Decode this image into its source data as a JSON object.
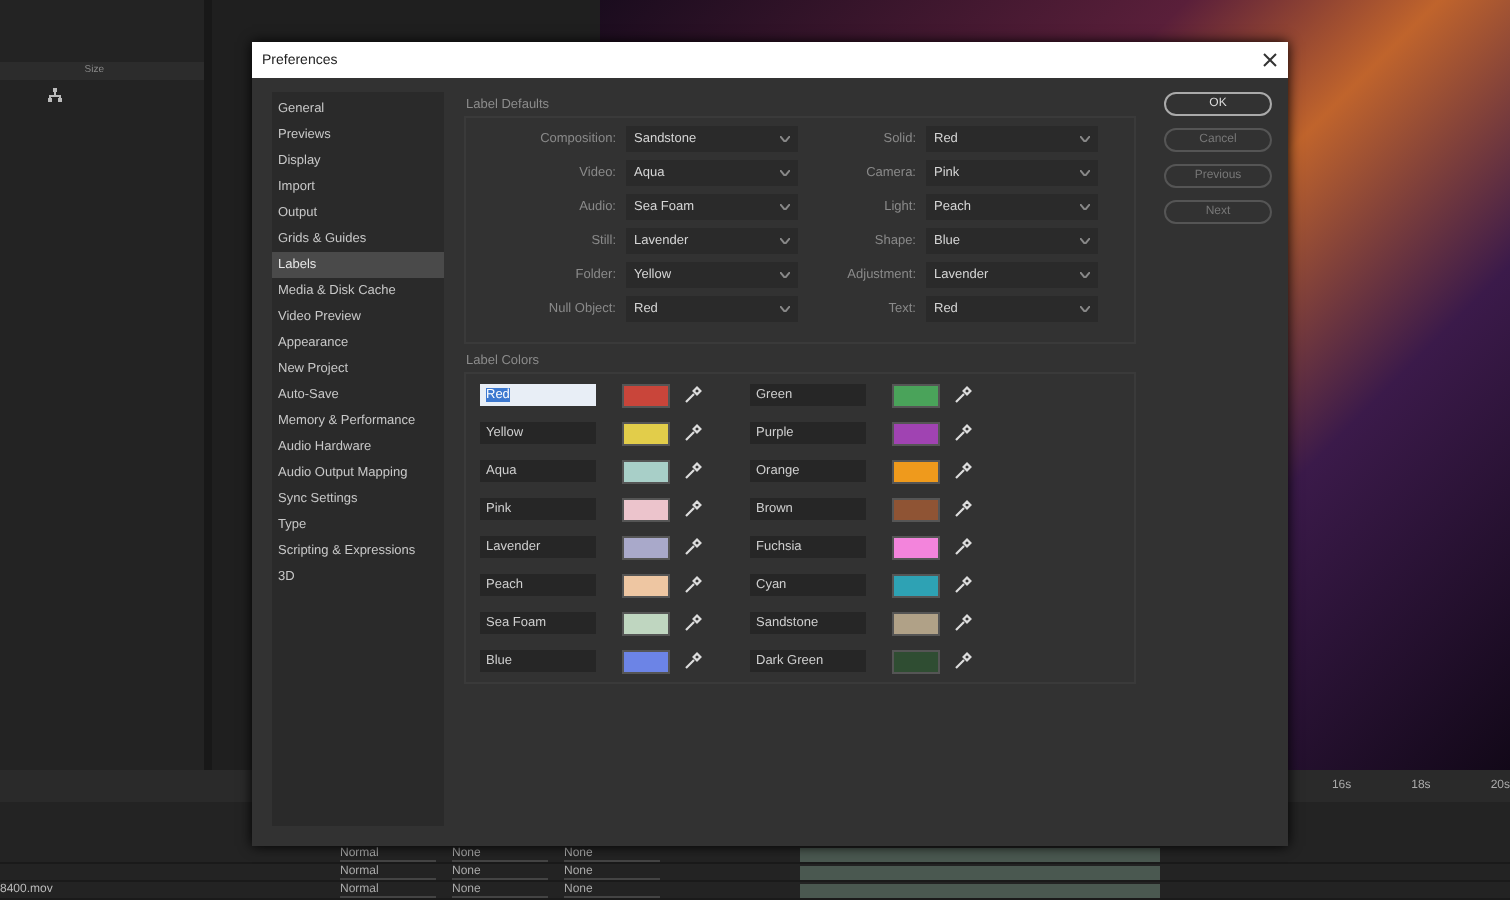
{
  "project_panel": {
    "column_header": "Size"
  },
  "timeline": {
    "ruler": [
      "16s",
      "18s",
      "20s"
    ],
    "layers": [
      {
        "mode": "Normal",
        "track_matte": "None",
        "parent": "None"
      },
      {
        "mode": "Normal",
        "track_matte": "None",
        "parent": "None"
      },
      {
        "name": "8400.mov",
        "mode": "Normal",
        "track_matte": "None",
        "parent": "None"
      }
    ]
  },
  "dialog": {
    "title": "Preferences",
    "sidebar": [
      {
        "label": "General",
        "selected": false
      },
      {
        "label": "Previews",
        "selected": false
      },
      {
        "label": "Display",
        "selected": false
      },
      {
        "label": "Import",
        "selected": false
      },
      {
        "label": "Output",
        "selected": false
      },
      {
        "label": "Grids & Guides",
        "selected": false
      },
      {
        "label": "Labels",
        "selected": true
      },
      {
        "label": "Media & Disk Cache",
        "selected": false
      },
      {
        "label": "Video Preview",
        "selected": false
      },
      {
        "label": "Appearance",
        "selected": false
      },
      {
        "label": "New Project",
        "selected": false
      },
      {
        "label": "Auto-Save",
        "selected": false
      },
      {
        "label": "Memory & Performance",
        "selected": false
      },
      {
        "label": "Audio Hardware",
        "selected": false
      },
      {
        "label": "Audio Output Mapping",
        "selected": false
      },
      {
        "label": "Sync Settings",
        "selected": false
      },
      {
        "label": "Type",
        "selected": false
      },
      {
        "label": "Scripting & Expressions",
        "selected": false
      },
      {
        "label": "3D",
        "selected": false
      }
    ],
    "label_defaults": {
      "title": "Label Defaults",
      "fields": [
        {
          "label": "Composition:",
          "value": "Sandstone"
        },
        {
          "label": "Solid:",
          "value": "Red"
        },
        {
          "label": "Video:",
          "value": "Aqua"
        },
        {
          "label": "Camera:",
          "value": "Pink"
        },
        {
          "label": "Audio:",
          "value": "Sea Foam"
        },
        {
          "label": "Light:",
          "value": "Peach"
        },
        {
          "label": "Still:",
          "value": "Lavender"
        },
        {
          "label": "Shape:",
          "value": "Blue"
        },
        {
          "label": "Folder:",
          "value": "Yellow"
        },
        {
          "label": "Adjustment:",
          "value": "Lavender"
        },
        {
          "label": "Null Object:",
          "value": "Red"
        },
        {
          "label": "Text:",
          "value": "Red"
        }
      ]
    },
    "label_colors": {
      "title": "Label Colors",
      "columns": [
        [
          {
            "name": "Red",
            "color": "#c9453a",
            "selected": true
          },
          {
            "name": "Yellow",
            "color": "#e2cd4a",
            "selected": false
          },
          {
            "name": "Aqua",
            "color": "#a8cfc8",
            "selected": false
          },
          {
            "name": "Pink",
            "color": "#ecc4cc",
            "selected": false
          },
          {
            "name": "Lavender",
            "color": "#a9a9ca",
            "selected": false
          },
          {
            "name": "Peach",
            "color": "#eec6a2",
            "selected": false
          },
          {
            "name": "Sea Foam",
            "color": "#bfd6c0",
            "selected": false
          },
          {
            "name": "Blue",
            "color": "#6c84e6",
            "selected": false
          }
        ],
        [
          {
            "name": "Green",
            "color": "#4aa35a",
            "selected": false
          },
          {
            "name": "Purple",
            "color": "#a043b2",
            "selected": false
          },
          {
            "name": "Orange",
            "color": "#ef9a1c",
            "selected": false
          },
          {
            "name": "Brown",
            "color": "#8f5434",
            "selected": false
          },
          {
            "name": "Fuchsia",
            "color": "#f384dc",
            "selected": false
          },
          {
            "name": "Cyan",
            "color": "#2ea2b4",
            "selected": false
          },
          {
            "name": "Sandstone",
            "color": "#b0a187",
            "selected": false
          },
          {
            "name": "Dark Green",
            "color": "#2f4d32",
            "selected": false
          }
        ]
      ]
    },
    "buttons": [
      {
        "label": "OK",
        "default": true
      },
      {
        "label": "Cancel",
        "default": false
      },
      {
        "label": "Previous",
        "default": false
      },
      {
        "label": "Next",
        "default": false
      }
    ]
  }
}
